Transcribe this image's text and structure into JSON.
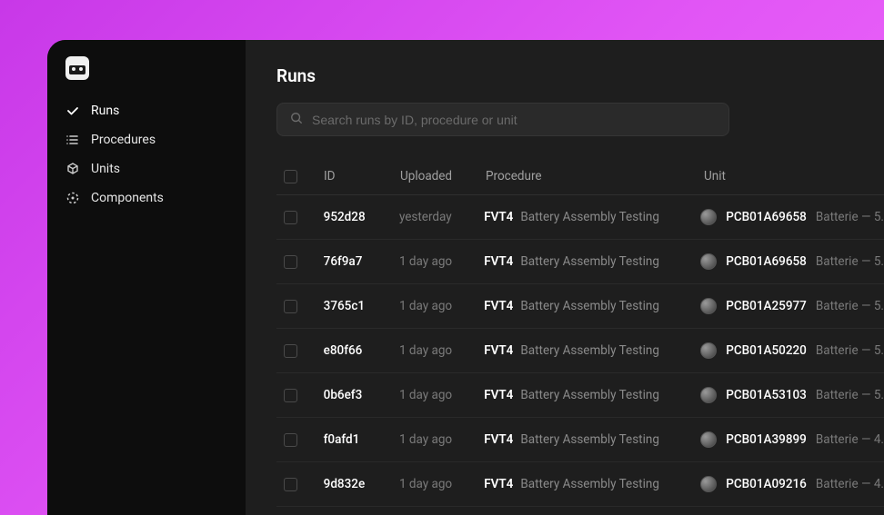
{
  "sidebar": {
    "items": [
      {
        "label": "Runs",
        "icon": "check"
      },
      {
        "label": "Procedures",
        "icon": "list"
      },
      {
        "label": "Units",
        "icon": "cube"
      },
      {
        "label": "Components",
        "icon": "circle-dashed"
      }
    ]
  },
  "page": {
    "title": "Runs",
    "search_placeholder": "Search runs by ID, procedure or unit"
  },
  "table": {
    "headers": {
      "id": "ID",
      "uploaded": "Uploaded",
      "procedure": "Procedure",
      "unit": "Unit"
    },
    "rows": [
      {
        "id": "952d28",
        "uploaded": "yesterday",
        "proc_code": "FVT4",
        "proc_name": "Battery Assembly Testing",
        "unit_code": "PCB01A69658",
        "unit_desc": "Batterie — 5."
      },
      {
        "id": "76f9a7",
        "uploaded": "1 day ago",
        "proc_code": "FVT4",
        "proc_name": "Battery Assembly Testing",
        "unit_code": "PCB01A69658",
        "unit_desc": "Batterie — 5."
      },
      {
        "id": "3765c1",
        "uploaded": "1 day ago",
        "proc_code": "FVT4",
        "proc_name": "Battery Assembly Testing",
        "unit_code": "PCB01A25977",
        "unit_desc": "Batterie — 5."
      },
      {
        "id": "e80f66",
        "uploaded": "1 day ago",
        "proc_code": "FVT4",
        "proc_name": "Battery Assembly Testing",
        "unit_code": "PCB01A50220",
        "unit_desc": "Batterie — 5."
      },
      {
        "id": "0b6ef3",
        "uploaded": "1 day ago",
        "proc_code": "FVT4",
        "proc_name": "Battery Assembly Testing",
        "unit_code": "PCB01A53103",
        "unit_desc": "Batterie — 5."
      },
      {
        "id": "f0afd1",
        "uploaded": "1 day ago",
        "proc_code": "FVT4",
        "proc_name": "Battery Assembly Testing",
        "unit_code": "PCB01A39899",
        "unit_desc": "Batterie — 4."
      },
      {
        "id": "9d832e",
        "uploaded": "1 day ago",
        "proc_code": "FVT4",
        "proc_name": "Battery Assembly Testing",
        "unit_code": "PCB01A09216",
        "unit_desc": "Batterie — 4."
      }
    ]
  }
}
